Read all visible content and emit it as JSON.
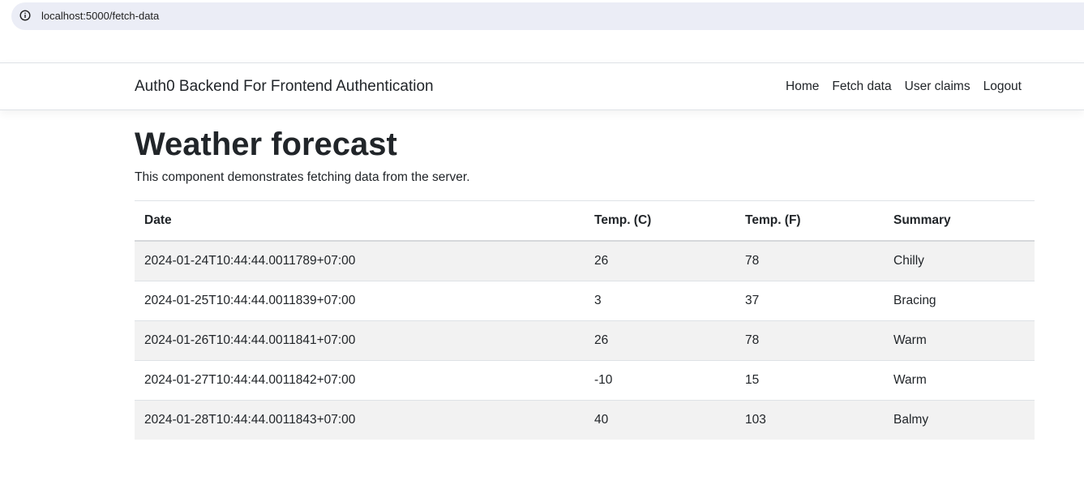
{
  "browser": {
    "url": "localhost:5000/fetch-data"
  },
  "navbar": {
    "brand": "Auth0 Backend For Frontend Authentication",
    "links": [
      "Home",
      "Fetch data",
      "User claims",
      "Logout"
    ]
  },
  "page": {
    "title": "Weather forecast",
    "description": "This component demonstrates fetching data from the server."
  },
  "table": {
    "headers": [
      "Date",
      "Temp. (C)",
      "Temp. (F)",
      "Summary"
    ],
    "rows": [
      [
        "2024-01-24T10:44:44.0011789+07:00",
        "26",
        "78",
        "Chilly"
      ],
      [
        "2024-01-25T10:44:44.0011839+07:00",
        "3",
        "37",
        "Bracing"
      ],
      [
        "2024-01-26T10:44:44.0011841+07:00",
        "26",
        "78",
        "Warm"
      ],
      [
        "2024-01-27T10:44:44.0011842+07:00",
        "-10",
        "15",
        "Warm"
      ],
      [
        "2024-01-28T10:44:44.0011843+07:00",
        "40",
        "103",
        "Balmy"
      ]
    ]
  },
  "icons": {
    "address_info": "info-circle-icon"
  }
}
